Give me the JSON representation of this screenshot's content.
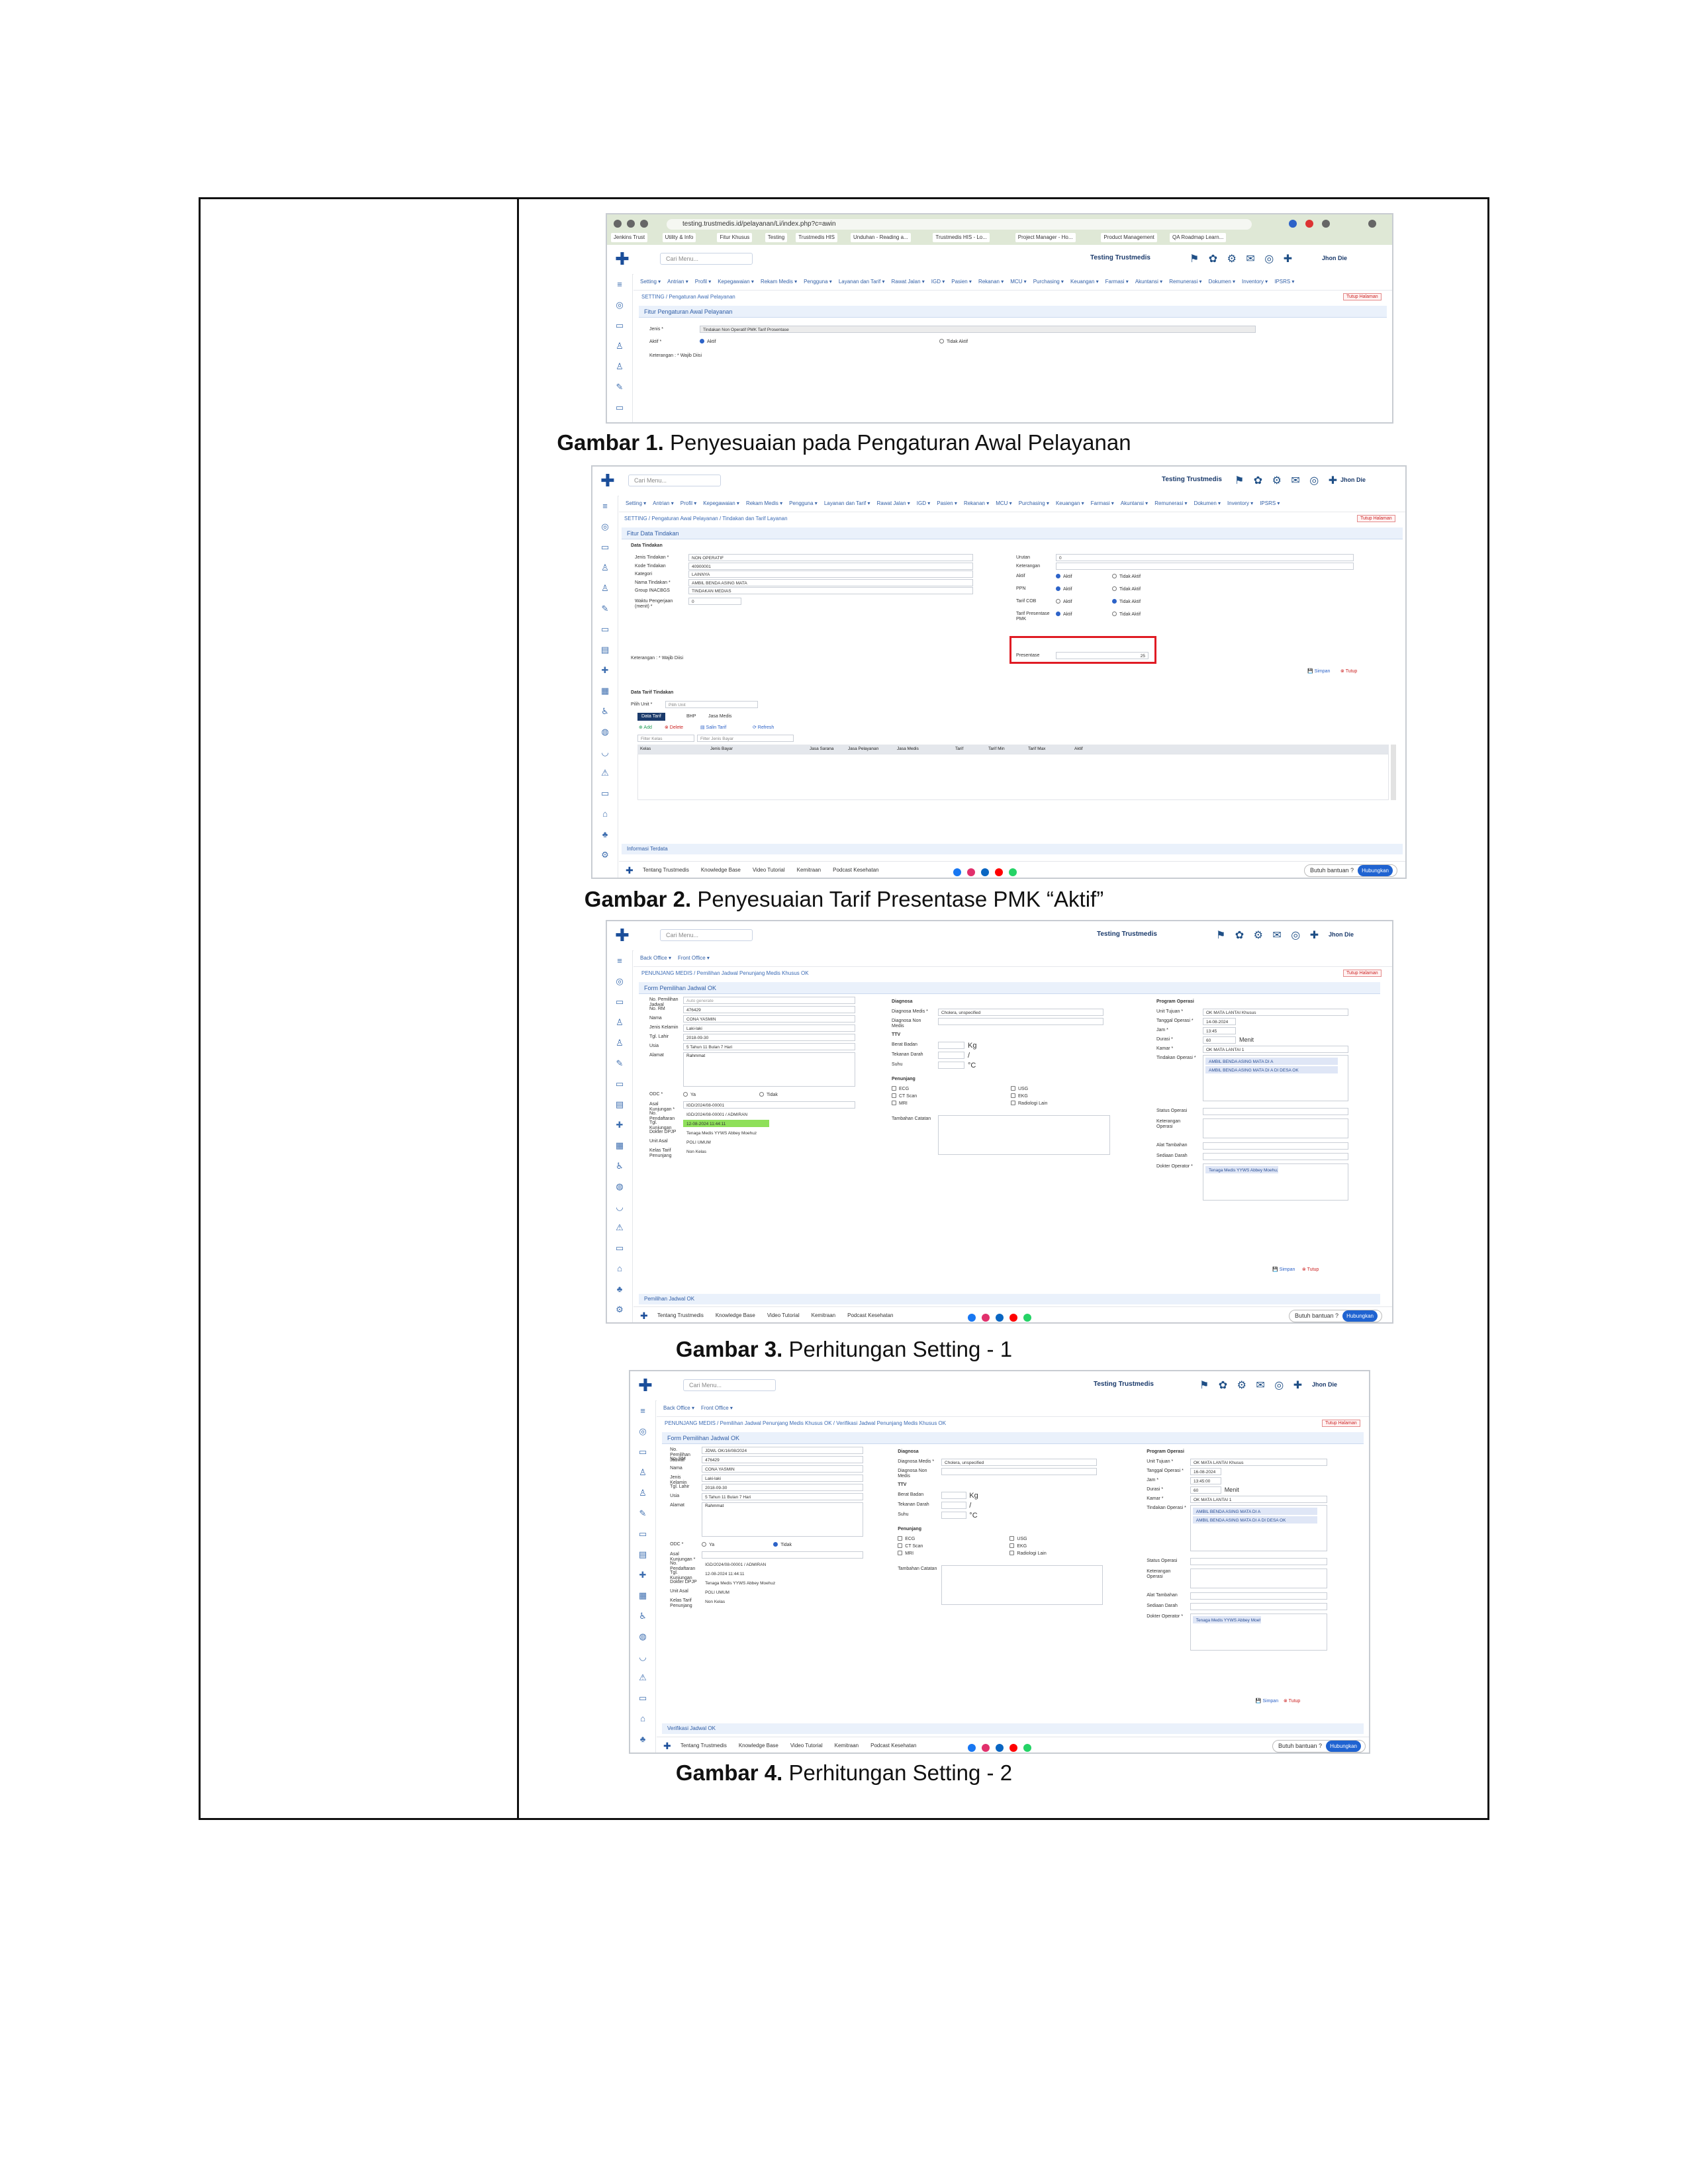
{
  "captions": [
    {
      "label": "Gambar 1.",
      "text": " Penyesuaian pada Pengaturan Awal Pelayanan"
    },
    {
      "label": "Gambar 2.",
      "text": " Penyesuaian Tarif Presentase PMK “Aktif”"
    },
    {
      "label": "Gambar 3.",
      "text": " Perhitungan Setting - 1"
    },
    {
      "label": "Gambar 4.",
      "text": " Perhitungan Setting - 2"
    }
  ],
  "common": {
    "search_placeholder": "Cari Menu...",
    "brand": "Testing Trustmedis",
    "user": "Jhon Die",
    "close_page": "Tutup Halaman",
    "save": "Simpan",
    "close": "Tutup",
    "footer_links": [
      "Tentang Trustmedis",
      "Knowledge Base",
      "Video Tutorial",
      "Kemitraan",
      "Podcast Kesehatan"
    ],
    "help": "Butuh bantuan ?",
    "help_btn": "Hubungkan",
    "social_colors": [
      "#1877f2",
      "#e1306c",
      "#0a66c2",
      "#ff0000",
      "#25d366"
    ]
  },
  "shot1": {
    "url": "testing.trustmedis.id/pelayanan/Li/index.php?c=awin",
    "bookmarks": [
      "Jenkins Trust",
      "Utility & Info",
      "Fitur Khusus",
      "Testing",
      "Trustmedis HIS",
      "Unduhan - Reading a...",
      "Trustmedis HIS - Lo...",
      "Project Manager - Ho...",
      "Product Management",
      "QA Roadmap Learn..."
    ],
    "menu": [
      "Setting",
      "Antrian",
      "Profil",
      "Kepegawaian",
      "Rekam Medis",
      "Pengguna",
      "Layanan dan Tarif",
      "Rawat Jalan",
      "IGD",
      "Pasien",
      "Rekanan",
      "MCU",
      "Purchasing",
      "Keuangan",
      "Farmasi",
      "Akuntansi",
      "Remunerasi",
      "Dokumen",
      "Inventory",
      "IPSRS"
    ],
    "breadcrumb": [
      "SETTING",
      "Pengaturan Awal Pelayanan"
    ],
    "panel_title": "Fitur Pengaturan Awal Pelayanan",
    "jenis_label": "Jenis *",
    "jenis_value": "Tindakan Non Operatif PMK Tarif Prosentase",
    "aktif_label": "Aktif *",
    "opt_aktif": "Aktif",
    "opt_tidak": "Tidak Aktif",
    "note": "Keterangan : * Wajib Diisi"
  },
  "shot2": {
    "menu": [
      "Setting",
      "Antrian",
      "Profil",
      "Kepegawaian",
      "Rekam Medis",
      "Pengguna",
      "Layanan dan Tarif",
      "Rawat Jalan",
      "IGD",
      "Pasien",
      "Rekanan",
      "MCU",
      "Purchasing",
      "Keuangan",
      "Farmasi",
      "Akuntansi",
      "Remunerasi",
      "Dokumen",
      "Inventory",
      "IPSRS"
    ],
    "breadcrumb": [
      "SETTING",
      "Pengaturan Awal Pelayanan",
      "Tindakan dan Tarif Layanan"
    ],
    "panel_title": "Fitur Data Tindakan",
    "section": "Data Tindakan",
    "left_fields": [
      {
        "label": "Jenis Tindakan *",
        "value": "NON OPERATIF"
      },
      {
        "label": "Kode Tindakan",
        "value": "40900001"
      },
      {
        "label": "Kategori",
        "value": "LAINNYA"
      },
      {
        "label": "Nama Tindakan *",
        "value": "AMBIL BENDA ASING MATA"
      },
      {
        "label": "Group INACBGS",
        "value": "TINDAKAN MEDIAS"
      },
      {
        "label": "Waktu Pengerjaan (menit) *",
        "value": "0"
      }
    ],
    "right_fields": [
      {
        "label": "Urutan",
        "value": "0"
      },
      {
        "label": "Keterangan",
        "value": ""
      }
    ],
    "radios": [
      {
        "label": "Aktif",
        "a": "Aktif",
        "b": "Tidak Aktif",
        "on": "a"
      },
      {
        "label": "PPN",
        "a": "Aktif",
        "b": "Tidak Aktif",
        "on": "a"
      },
      {
        "label": "Tarif COB",
        "a": "Aktif",
        "b": "Tidak Aktif",
        "on": "b"
      },
      {
        "label": "Tarif Presentase PMK",
        "a": "Aktif",
        "b": "Tidak Aktif",
        "on": "a"
      }
    ],
    "presentase_label": "Presentase",
    "presentase_value": "25",
    "note": "Keterangan : * Wajib Diisi",
    "tarif_section": "Data Tarif Tindakan",
    "pilih_unit": "Pilih Unit *",
    "pilih_unit_ph": "Pilih Unit",
    "tabs": [
      "Data Tarif",
      "BHP",
      "Jasa Medis"
    ],
    "actions": [
      "Add",
      "Delete",
      "Salin Tarif",
      "Refresh"
    ],
    "filter_kelas": "Filter Kelas",
    "filter_jenis": "Filter Jenis Bayar",
    "columns": [
      "Kelas",
      "Jenis Bayar",
      "Jasa Sarana",
      "Jasa Pelayanan",
      "Jasa Medis",
      "Tarif",
      "Tarif Min",
      "Tarif Max",
      "Aktif"
    ],
    "info": "Informasi Terdata"
  },
  "shot3": {
    "menu": [
      "Back Office",
      "Front Office"
    ],
    "breadcrumb": [
      "PENUNJANG MEDIS",
      "Pemilihan Jadwal Penunjang Medis Khusus OK"
    ],
    "panel_title": "Form Pemilihan Jadwal OK",
    "left_fields": [
      {
        "label": "No. Pemilihan Jadwal",
        "value": "Auto generate"
      },
      {
        "label": "No. RM",
        "value": "476429"
      },
      {
        "label": "Nama",
        "value": "CONA YASMIN"
      },
      {
        "label": "Jenis Kelamin",
        "value": "Laki-laki"
      },
      {
        "label": "Tgl. Lahir",
        "value": "2018-09-30"
      },
      {
        "label": "Usia",
        "value": "5 Tahun 11 Bulan 7 Hari"
      },
      {
        "label": "Alamat",
        "value": "Rahmmat"
      }
    ],
    "left_fields2": [
      {
        "label": "Asal Kunjungan *",
        "value": "IGD/2024/08-00001"
      },
      {
        "label": "No. Pendaftaran",
        "value": "IGD/2024/08-00001 / ADMIRAN"
      },
      {
        "label": "Tgl. Kunjungan",
        "value": "12-08-2024 11:44:11"
      },
      {
        "label": "Dokter DPJP",
        "value": "Tenaga Medis YYWS Abbey Moehuz"
      },
      {
        "label": "Unit Asal",
        "value": "POLI UMUM"
      },
      {
        "label": "Kelas Tarif Penunjang",
        "value": "Non Kelas"
      }
    ],
    "odc_label": "ODC *",
    "odc_ya": "Ya",
    "odc_tidak": "Tidak",
    "diagnosa_title": "Diagnosa",
    "diag_fields": [
      {
        "label": "Diagnosa Medis *",
        "value": "Cholera, unspecified"
      },
      {
        "label": "Diagnosa Non Medis",
        "value": ""
      }
    ],
    "ttv_title": "TTV",
    "ttv": [
      {
        "label": "Berat Badan",
        "unit": "Kg"
      },
      {
        "label": "Tekanan Darah",
        "unit": "/"
      },
      {
        "label": "Suhu",
        "unit": "°C"
      }
    ],
    "penunjang_title": "Penunjang",
    "penunjang": [
      "ECG",
      "USG",
      "CT Scan",
      "EKG",
      "MRI",
      "Radiologi Lain"
    ],
    "catatan_label": "Tambahan Catatan",
    "program_title": "Program Operasi",
    "program": [
      {
        "label": "Unit Tujuan *",
        "value": "OK MATA LANTAI Khusus"
      },
      {
        "label": "Tanggal Operasi *",
        "value": "14-08-2024"
      },
      {
        "label": "Jam *",
        "value": "13:45"
      },
      {
        "label": "Durasi *",
        "value": "60"
      },
      {
        "label": "Kamar *",
        "value": "OK MATA LANTAI 1"
      }
    ],
    "menit": "Menit",
    "tindakan_label": "Tindakan Operasi *",
    "tindakan_chips": [
      "AMBIL BENDA ASING MATA DI A",
      "AMBIL BENDA ASING MATA DI A DI DESA OK"
    ],
    "status_label": "Status Operasi",
    "ket_label": "Keterangan Operasi",
    "alat_label": "Alat Tambahan",
    "sediaan_label": "Sediaan Darah",
    "dokter_label": "Dokter Operator *",
    "dokter_chip": "Tenaga Medis YYWS Abbey Moehuz",
    "info": "Pemilihan Jadwal OK"
  },
  "shot4": {
    "menu": [
      "Back Office",
      "Front Office"
    ],
    "breadcrumb": [
      "PENUNJANG MEDIS",
      "Pemilihan Jadwal Penunjang Medis Khusus OK",
      "Verifikasi Jadwal Penunjang Medis Khusus OK"
    ],
    "panel_title": "Form Pemilihan Jadwal OK",
    "left_fields": [
      {
        "label": "No. Pemilihan Jadwal",
        "value": "JDWL OK/16/08/2024"
      },
      {
        "label": "No. RM",
        "value": "476429"
      },
      {
        "label": "Nama",
        "value": "CONA YASMIN"
      },
      {
        "label": "Jenis Kelamin",
        "value": "Laki-laki"
      },
      {
        "label": "Tgl. Lahir",
        "value": "2018-09-30"
      },
      {
        "label": "Usia",
        "value": "5 Tahun 11 Bulan 7 Hari"
      },
      {
        "label": "Alamat",
        "value": "Rahmmat"
      }
    ],
    "left_fields2": [
      {
        "label": "Asal Kunjungan *",
        "value": ""
      },
      {
        "label": "No. Pendaftaran",
        "value": "IGD/2024/08-00001 / ADMIRAN"
      },
      {
        "label": "Tgl. Kunjungan",
        "value": "12-08-2024 11:44:11"
      },
      {
        "label": "Dokter DPJP",
        "value": "Tenaga Medis YYWS Abbey Moehuz"
      },
      {
        "label": "Unit Asal",
        "value": "POLI UMUM"
      },
      {
        "label": "Kelas Tarif Penunjang",
        "value": "Non Kelas"
      }
    ],
    "program": [
      {
        "label": "Unit Tujuan *",
        "value": "OK MATA LANTAI Khusus"
      },
      {
        "label": "Tanggal Operasi *",
        "value": "16-08-2024"
      },
      {
        "label": "Jam *",
        "value": "13:45:00"
      },
      {
        "label": "Durasi *",
        "value": "60"
      },
      {
        "label": "Kamar *",
        "value": "OK MATA LANTAI 1"
      }
    ],
    "tindakan_chips": [
      "AMBIL BENDA ASING MATA DI A",
      "AMBIL BENDA ASING MATA DI A DI DESA OK"
    ],
    "dokter_chip": "Tenaga Medis YYWS Abbey Moehuz",
    "info": "Verifikasi Jadwal OK"
  }
}
